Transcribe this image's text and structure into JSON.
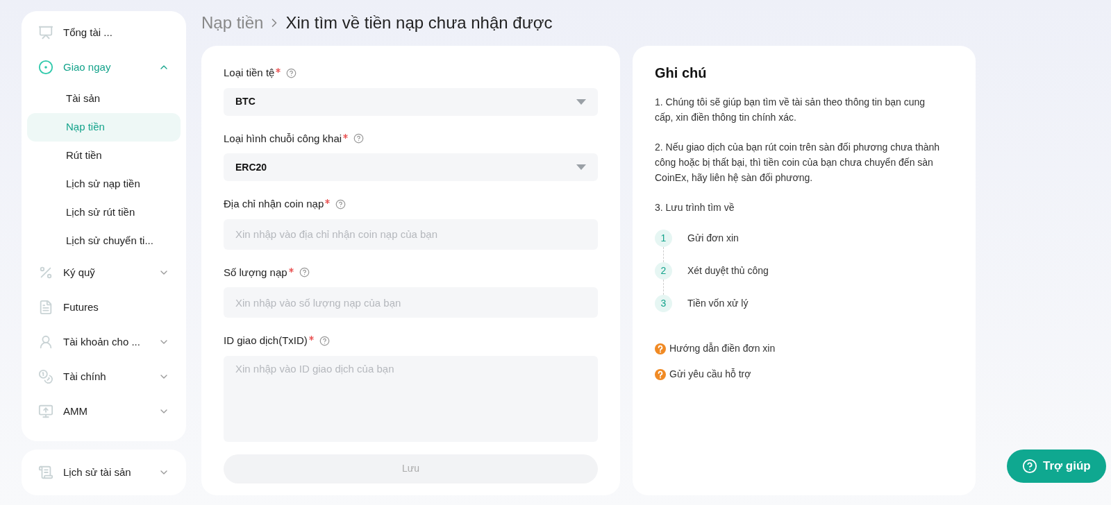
{
  "sidebar": {
    "sections": [
      {
        "items": [
          {
            "kind": "link",
            "label": "Tổng tài ...",
            "selected": false
          },
          {
            "kind": "group",
            "label": "Giao ngay",
            "selected": true,
            "expanded": true,
            "children": [
              {
                "label": "Tài sản",
                "selected": false
              },
              {
                "label": "Nạp tiền",
                "selected": true
              },
              {
                "label": "Rút tiền",
                "selected": false
              },
              {
                "label": "Lịch sử nạp tiền",
                "selected": false
              },
              {
                "label": "Lịch sử rút tiền",
                "selected": false
              },
              {
                "label": "Lịch sử chuyển ti...",
                "selected": false
              }
            ]
          },
          {
            "kind": "group",
            "label": "Ký quỹ",
            "selected": false,
            "expanded": false
          },
          {
            "kind": "link",
            "label": "Futures",
            "selected": false
          },
          {
            "kind": "group",
            "label": "Tài khoản cho ...",
            "selected": false,
            "expanded": false
          },
          {
            "kind": "group",
            "label": "Tài chính",
            "selected": false,
            "expanded": false
          },
          {
            "kind": "group",
            "label": "AMM",
            "selected": false,
            "expanded": false
          }
        ]
      },
      {
        "items": [
          {
            "kind": "group",
            "label": "Lịch sử tài sản",
            "selected": false,
            "expanded": false
          }
        ]
      }
    ]
  },
  "breadcrumb": [
    "Nạp tiền",
    "Xin tìm về tiền nạp chưa nhận được"
  ],
  "form": {
    "fields": [
      {
        "kind": "select",
        "label": "Loại tiền tệ",
        "required": true,
        "value": "BTC"
      },
      {
        "kind": "select",
        "label": "Loại hình chuỗi công khai",
        "required": true,
        "value": "ERC20"
      },
      {
        "kind": "input",
        "label": "Địa chỉ nhận coin nạp",
        "required": true,
        "placeholder": "Xin nhập vào địa chỉ nhận coin nạp của bạn"
      },
      {
        "kind": "input",
        "label": "Số lượng nạp",
        "required": true,
        "placeholder": "Xin nhập vào số lượng nạp của bạn"
      },
      {
        "kind": "textarea",
        "label": "ID giao dịch(TxID)",
        "required": true,
        "placeholder": "Xin nhập vào ID giao dịch của bạn"
      }
    ],
    "submit": {
      "label": "Lưu",
      "disabled": true
    }
  },
  "notes": {
    "title": "Ghi chú",
    "paragraphs": [
      "1. Chúng tôi sẽ giúp bạn tìm về tài sản theo thông tin bạn cung cấp, xin điền thông tin chính xác.",
      "2. Nếu giao dịch của bạn rút coin trên sàn đối phương chưa thành công hoặc bị thất bại, thì tiền coin của bạn chưa chuyển đến sàn CoinEx, hãy liên hệ sàn đối phương.",
      "3. Lưu trình tìm về"
    ],
    "steps": [
      {
        "number": "1",
        "label": "Gửi đơn xin"
      },
      {
        "number": "2",
        "label": "Xét duyệt thủ công"
      },
      {
        "number": "3",
        "label": "Tiền vốn xử lý"
      }
    ],
    "links": [
      "Hướng dẫn điền đơn xin",
      "Gửi yêu cầu hỗ trợ"
    ]
  },
  "help_button": {
    "label": "Trợ giúp"
  }
}
